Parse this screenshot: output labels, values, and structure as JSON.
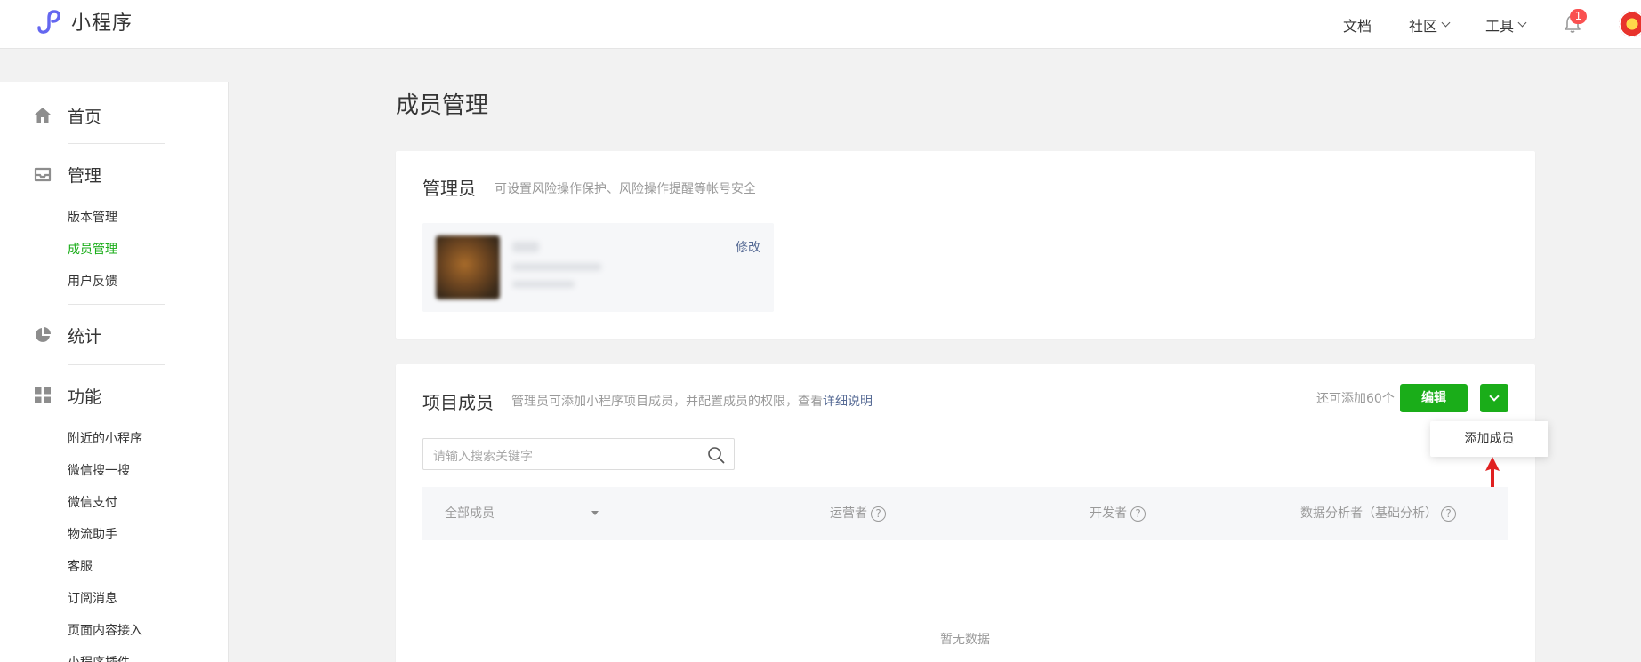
{
  "header": {
    "app_name": "小程序",
    "nav": [
      {
        "label": "文档",
        "has_dropdown": false
      },
      {
        "label": "社区",
        "has_dropdown": true
      },
      {
        "label": "工具",
        "has_dropdown": true
      }
    ],
    "notification_count": "1"
  },
  "sidebar": {
    "home": "首页",
    "manage": "管理",
    "manage_items": [
      "版本管理",
      "成员管理",
      "用户反馈"
    ],
    "active_item": "成员管理",
    "stats": "统计",
    "features": "功能",
    "feature_items": [
      "附近的小程序",
      "微信搜一搜",
      "微信支付",
      "物流助手",
      "客服",
      "订阅消息",
      "页面内容接入",
      "小程序插件"
    ]
  },
  "page": {
    "title": "成员管理",
    "admin": {
      "title": "管理员",
      "desc": "可设置风险操作保护、风险操作提醒等帐号安全",
      "edit": "修改"
    },
    "members": {
      "title": "项目成员",
      "desc": "管理员可添加小程序项目成员，并配置成员的权限，查看",
      "desc_link": "详细说明",
      "remaining": "还可添加60个",
      "edit_button": "编辑",
      "menu_item": "添加成员",
      "search_placeholder": "请输入搜索关键字",
      "columns": {
        "all": "全部成员",
        "operator": "运营者",
        "developer": "开发者",
        "analyst": "数据分析者（基础分析）"
      },
      "empty": "暂无数据"
    }
  },
  "colors": {
    "primary_green": "#1aad19",
    "link_blue": "#576b95",
    "badge_red": "#fa5151",
    "annotation_red": "#e02020"
  }
}
